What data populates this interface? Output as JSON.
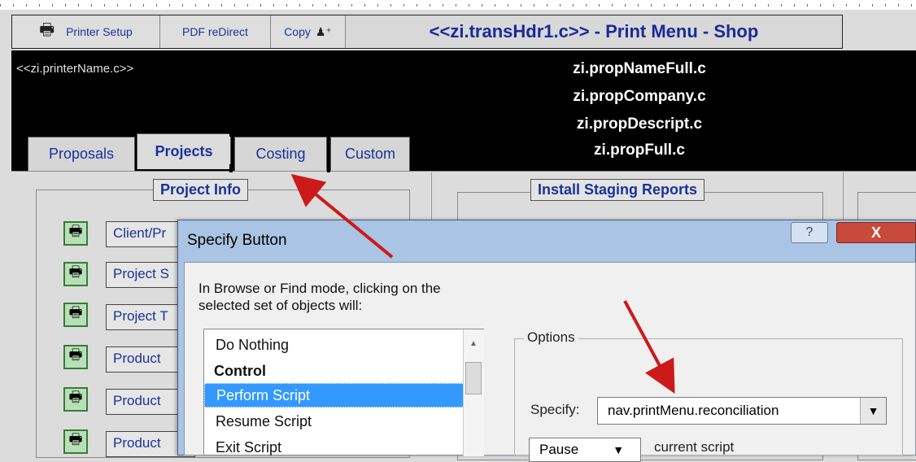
{
  "toolbar": {
    "printer_setup": "Printer Setup",
    "pdf_redirect": "PDF reDirect",
    "copy": "Copy",
    "title": "<<zi.transHdr1.c>> - Print Menu - Shop"
  },
  "header": {
    "printer_name": "<<zi.printerName.c>>",
    "prop_lines": [
      "zi.propNameFull.c",
      "zi.propCompany.c",
      "zi.propDescript.c",
      "zi.propFull.c"
    ]
  },
  "tabs": [
    "Proposals",
    "Projects",
    "Costing",
    "Custom"
  ],
  "active_tab": "Projects",
  "groups": {
    "project_info": "Project Info",
    "install_staging": "Install Staging Reports"
  },
  "report_buttons": [
    "Client/Pr",
    "Project S",
    "Project T",
    "Product",
    "Product",
    "Product"
  ],
  "dialog": {
    "title": "Specify Button",
    "help": "?",
    "close": "X",
    "instructions": "In Browse or Find mode, clicking on the selected set of objects will:",
    "actions": [
      {
        "label": "Do Nothing",
        "kind": "item"
      },
      {
        "label": "Control",
        "kind": "heading"
      },
      {
        "label": "Perform Script",
        "kind": "selected"
      },
      {
        "label": "Resume Script",
        "kind": "item"
      },
      {
        "label": "Exit Script",
        "kind": "item"
      }
    ],
    "options_label": "Options",
    "specify_label": "Specify:",
    "specify_value": "nav.printMenu.reconciliation",
    "pause_value": "Pause",
    "current_script": "current script"
  },
  "colors": {
    "arrow": "#cc1a1a",
    "selection": "#3399ff",
    "header_bg": "#000000"
  }
}
